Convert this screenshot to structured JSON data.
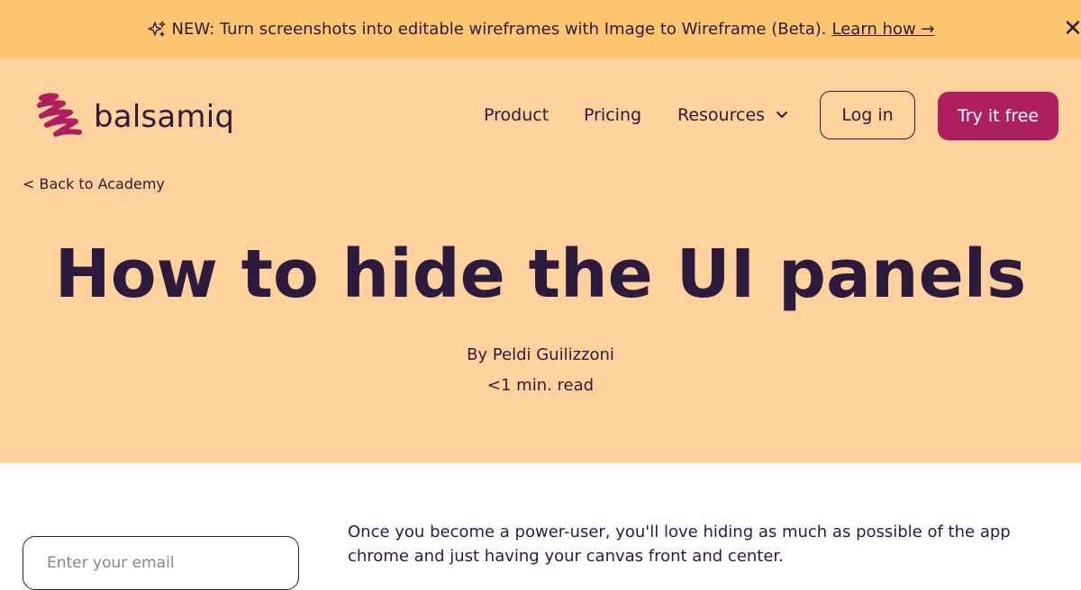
{
  "announcement": {
    "icon": "sparkle-icon",
    "text": "NEW: Turn screenshots into editable wireframes with Image to Wireframe (Beta).",
    "link": "Learn how →",
    "close": "✕"
  },
  "header": {
    "logo_text": "balsamiq",
    "nav": {
      "product": "Product",
      "pricing": "Pricing",
      "resources": "Resources"
    },
    "login": "Log in",
    "try_free": "Try it free"
  },
  "article": {
    "back_link": "< Back to Academy",
    "title": "How to hide the UI panels",
    "author": "By Peldi Guilizzoni",
    "read_time": "<1 min. read",
    "body": "Once you become a power-user, you'll love hiding as much as possible of the app chrome and just having your canvas front and center."
  },
  "sidebar": {
    "email_placeholder": "Enter your email"
  },
  "colors": {
    "banner_bg": "#fdc56f",
    "hero_bg": "#ffd19c",
    "brand": "#ad1f5f",
    "text": "#2d1b3d"
  }
}
